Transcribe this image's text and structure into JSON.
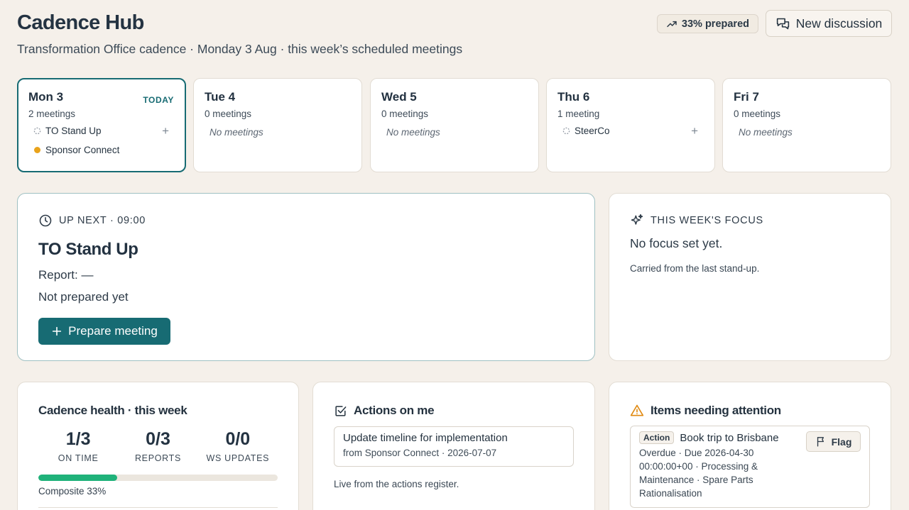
{
  "header": {
    "title": "Cadence Hub",
    "subtitle": "Transformation Office cadence · Monday 3 Aug · this week’s scheduled meetings",
    "prepared_badge": "33% prepared",
    "new_discussion_label": "New discussion"
  },
  "days": [
    {
      "name": "Mon 3",
      "count": "2 meetings",
      "today": "TODAY",
      "meetings": [
        {
          "title": "TO Stand Up",
          "marker": "pending"
        },
        {
          "title": "Sponsor Connect",
          "marker": "dot"
        }
      ]
    },
    {
      "name": "Tue 4",
      "count": "0 meetings",
      "empty": "No meetings"
    },
    {
      "name": "Wed 5",
      "count": "0 meetings",
      "empty": "No meetings"
    },
    {
      "name": "Thu 6",
      "count": "1 meeting",
      "meetings": [
        {
          "title": "SteerCo",
          "marker": "pending"
        }
      ]
    },
    {
      "name": "Fri 7",
      "count": "0 meetings",
      "empty": "No meetings"
    }
  ],
  "up_next": {
    "label": "UP NEXT · 09:00",
    "title": "TO Stand Up",
    "report": "Report: —",
    "status": "Not prepared yet",
    "prepare_label": "Prepare meeting"
  },
  "focus": {
    "label": "THIS WEEK'S FOCUS",
    "text": "No focus set yet.",
    "sub": "Carried from the last stand-up."
  },
  "health": {
    "title": "Cadence health · this week",
    "metrics": [
      {
        "value": "1/3",
        "label": "ON TIME"
      },
      {
        "value": "0/3",
        "label": "REPORTS"
      },
      {
        "value": "0/0",
        "label": "WS UPDATES"
      }
    ],
    "composite_pct": 33,
    "composite_label": "Composite 33%"
  },
  "actions": {
    "title": "Actions on me",
    "item_title": "Update timeline for implementation",
    "item_sub": "from Sponsor Connect · 2026-07-07",
    "footer": "Live from the actions register."
  },
  "attention": {
    "title": "Items needing attention",
    "chip": "Action",
    "item_title": "Book trip to Brisbane",
    "item_desc": "Overdue · Due 2026-04-30 00:00:00+00 · Processing & Maintenance · Spare Parts Rationalisation",
    "flag_label": "Flag"
  },
  "colors": {
    "accent": "#176b73",
    "progress": "#1fb27a",
    "warning": "#e9a31b",
    "background": "#f5f0ea"
  }
}
